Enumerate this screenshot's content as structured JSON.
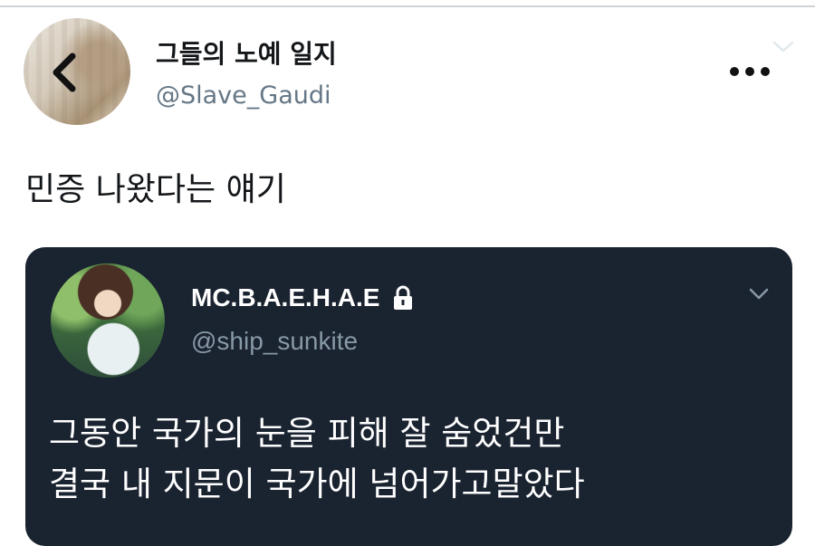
{
  "tweet": {
    "display_name": "그들의 노예 일지",
    "handle": "@Slave_Gaudi",
    "text": "민증 나왔다는 얘기"
  },
  "quoted_tweet": {
    "display_name": "MC.B.A.E.H.A.E",
    "handle": "@ship_sunkite",
    "protected": true,
    "text_lines": [
      "그동안 국가의 눈을 피해 잘 숨었건만",
      "결국 내 지문이 국가에 넘어가고말았다"
    ],
    "background_color": "#1a2330"
  },
  "icons": {
    "back": "chevron-left-icon",
    "more": "more-horizontal-icon",
    "caret": "chevron-down-icon",
    "lock": "lock-icon"
  },
  "colors": {
    "primary_text": "#14171a",
    "secondary_text": "#657786",
    "quote_secondary_text": "#8899a6"
  }
}
